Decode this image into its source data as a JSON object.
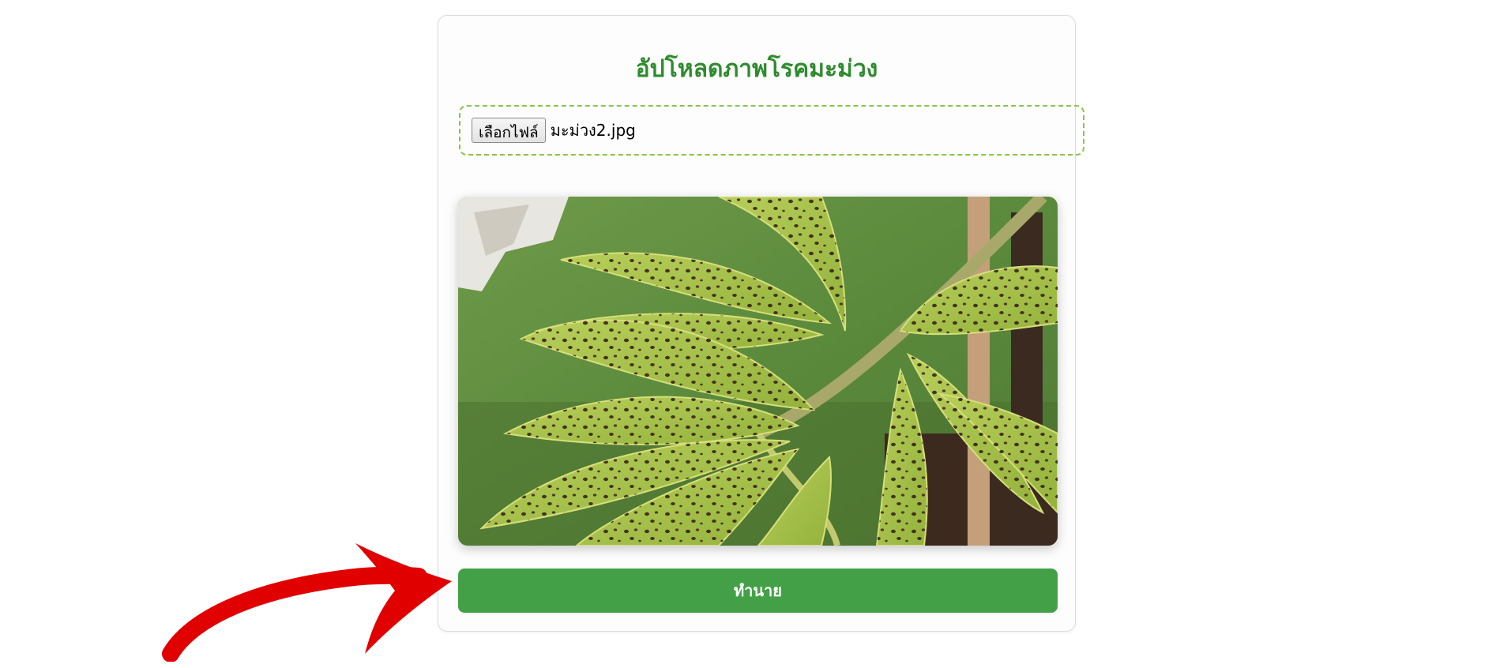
{
  "upload": {
    "title": "อัปโหลดภาพโรคมะม่วง",
    "choose_button_label": "เลือกไฟล์",
    "file_name": "มะม่วง2.jpg",
    "predict_button_label": "ทำนาย"
  },
  "preview": {
    "alt": "Mango leaves with dark disease spots"
  },
  "colors": {
    "title": "#2e8b2e",
    "dashed_border": "#8bc34a",
    "predict_button": "#43a047",
    "annotation_arrow": "#e00000"
  },
  "icons": {
    "annotation": "red-arrow-icon"
  }
}
